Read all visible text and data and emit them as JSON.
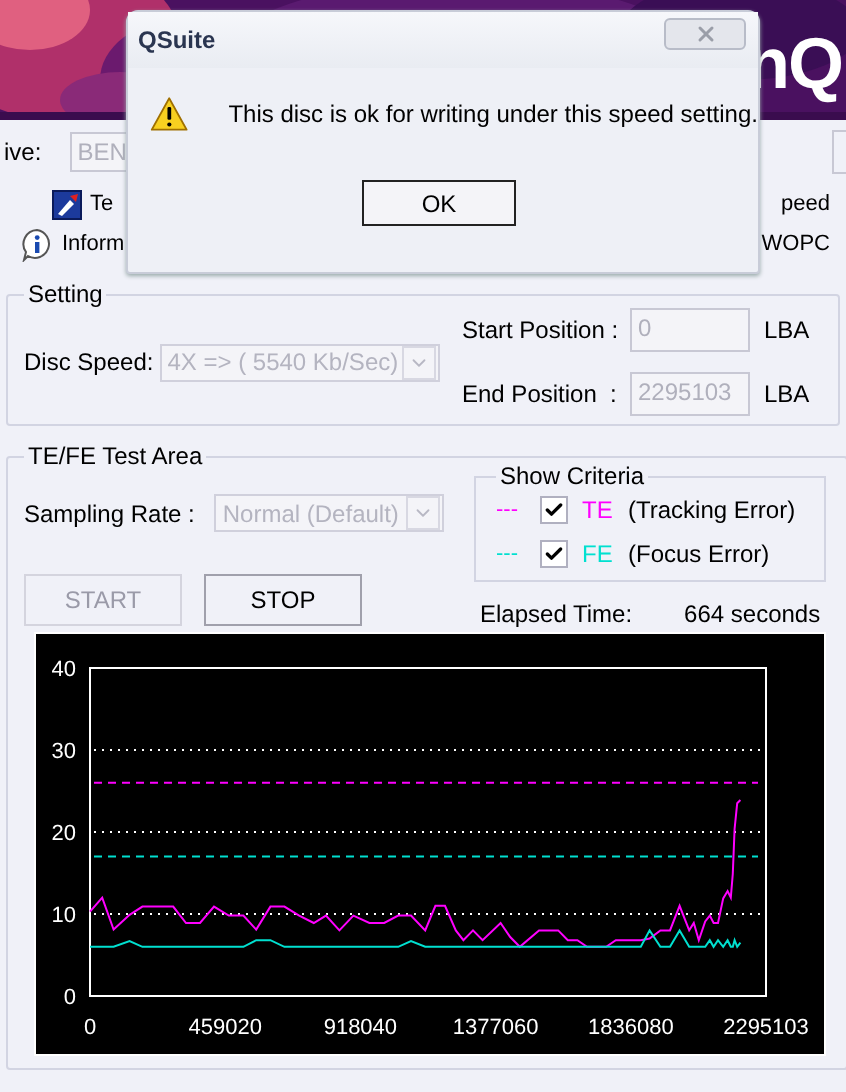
{
  "banner": {
    "logo": "nQ"
  },
  "drive": {
    "label": "ive:",
    "value": "BEN",
    "disabled": true
  },
  "toolbar_rows": [
    {
      "kind": "tool",
      "left": "Te",
      "right": "peed"
    },
    {
      "kind": "info",
      "left": "Inform",
      "right": "WOPC"
    }
  ],
  "setting": {
    "title": "Setting",
    "disc_speed": {
      "label": "Disc Speed:",
      "value": "4X => ( 5540 Kb/Sec)",
      "disabled": true
    },
    "positions": [
      {
        "label": "Start Position :",
        "value": "0",
        "unit": "LBA",
        "disabled": true
      },
      {
        "label": "End Position  :",
        "value": "2295103",
        "unit": "LBA",
        "disabled": true
      }
    ]
  },
  "test_area": {
    "title": "TE/FE Test Area",
    "sampling": {
      "label": "Sampling Rate :",
      "value": "Normal (Default)",
      "disabled": true
    },
    "criteria": {
      "title": "Show Criteria",
      "items": [
        {
          "dash": "---",
          "description": "(Tracking Error)",
          "checked": true
        },
        {
          "dash": "---",
          "description": "(Focus Error)",
          "checked": true
        }
      ]
    },
    "buttons": [
      {
        "label": "START",
        "disabled": true
      },
      {
        "label": "STOP",
        "disabled": false
      }
    ],
    "elapsed": {
      "label": "Elapsed Time:",
      "value": "664 seconds"
    },
    "chart_data": {
      "type": "line",
      "x": [
        0,
        41255,
        80338,
        134623,
        178045,
        282270,
        325698,
        373465,
        421235,
        471175,
        521118,
        564545,
        612310,
        660075,
        710020,
        759960,
        801210,
        846810,
        894580,
        948860,
        998800,
        1046570,
        1090000,
        1137770,
        1172500,
        1205080,
        1242000,
        1268050,
        1300620,
        1333190,
        1393980,
        1426550,
        1459130,
        1524270,
        1589410,
        1621980,
        1654550,
        1687120,
        1752260,
        1784830,
        1870000,
        1899910,
        1936820,
        1969400,
        2001970,
        2034540,
        2049740,
        2067110,
        2088820,
        2104020,
        2117050,
        2132250,
        2149620,
        2164820,
        2175680,
        2182190,
        2188700,
        2197390,
        2208240
      ],
      "series": [
        {
          "name": "TE",
          "color": "#ff00ff",
          "values": [
            10.3,
            12,
            8.1,
            9.9,
            10.9,
            10.9,
            8.9,
            8.9,
            10.9,
            9.8,
            9.8,
            8.1,
            10.9,
            10.9,
            9.8,
            8.9,
            9.8,
            8,
            9.8,
            8.9,
            8.9,
            9.8,
            9.8,
            8,
            11,
            11,
            8,
            6.8,
            8,
            6.8,
            8.9,
            7.2,
            6,
            8,
            8,
            6.8,
            6.8,
            6,
            6,
            6.8,
            6.8,
            7,
            8,
            8,
            11,
            8,
            8.9,
            6.8,
            9.1,
            9.8,
            8.9,
            8.9,
            11.9,
            12.8,
            12,
            14.9,
            20.4,
            23.5,
            23.9
          ]
        },
        {
          "name": "FE",
          "color": "#00e0d0",
          "values": [
            6,
            6,
            6,
            6.7,
            6,
            6,
            6,
            6,
            6,
            6,
            6,
            6.8,
            6.8,
            6,
            6,
            6,
            6,
            6,
            6,
            6,
            6,
            6,
            6.7,
            6,
            6,
            6,
            6,
            6,
            6,
            6,
            6,
            6,
            6,
            6,
            6,
            6,
            6,
            6,
            6,
            6,
            6,
            8,
            6,
            6,
            8,
            6,
            6,
            6,
            6,
            6.8,
            6,
            6.8,
            6,
            6.8,
            6,
            6,
            6.8,
            6,
            6.5
          ]
        }
      ],
      "xlim": [
        0,
        2295103
      ],
      "ylim": [
        0,
        40
      ],
      "xticks": [
        0,
        459020,
        918040,
        1377060,
        1836080,
        2295103
      ],
      "yticks": [
        0,
        10,
        20,
        30,
        40
      ],
      "grid": true,
      "ref_lines": [
        {
          "axis": "y",
          "value": 26,
          "color": "#ff00ff"
        },
        {
          "axis": "y",
          "value": 17,
          "color": "#00e0d0"
        }
      ]
    }
  },
  "dialog": {
    "title": "QSuite",
    "message": "This disc is ok for writing under this speed setting.",
    "button": "OK"
  }
}
